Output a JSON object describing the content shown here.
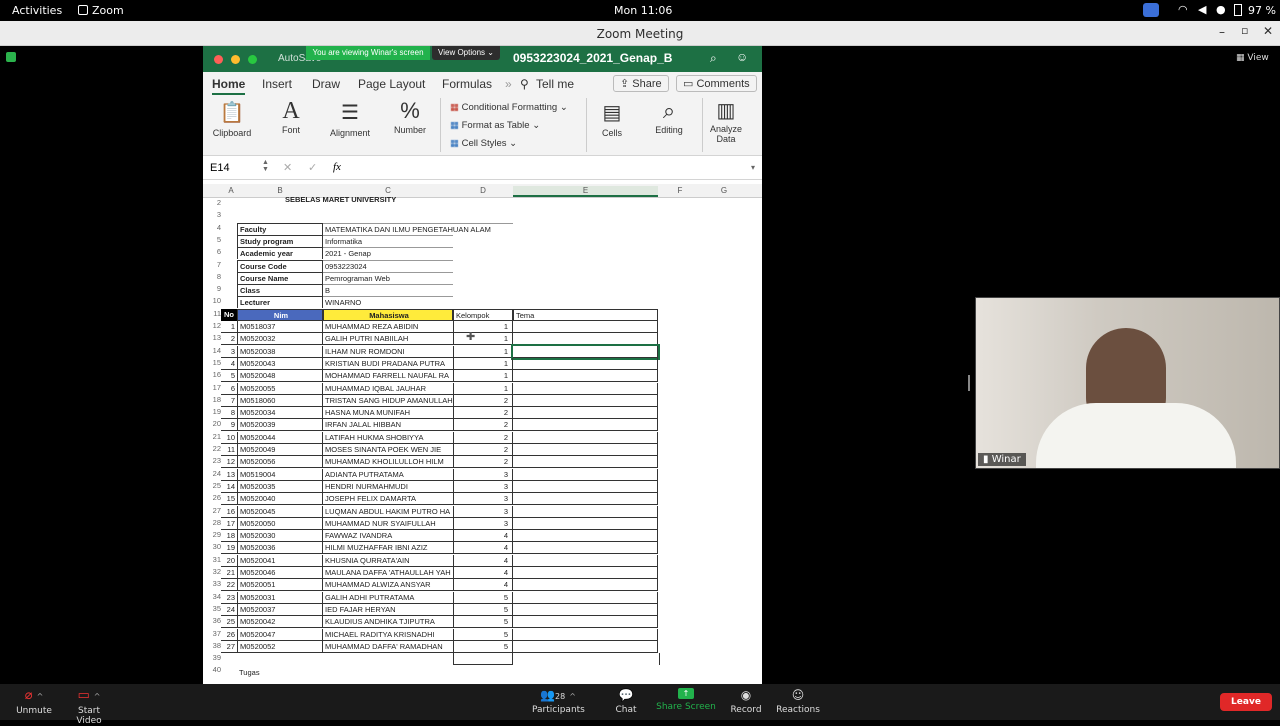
{
  "system": {
    "activities": "Activities",
    "app": "Zoom",
    "clock": "Mon 11:06",
    "battery": "97 %"
  },
  "window": {
    "title": "Zoom Meeting"
  },
  "share_banner": {
    "text": "You are viewing Winar's screen",
    "view_options": "View Options"
  },
  "excel": {
    "autosave": "AutoSave",
    "filename": "0953223024_2021_Genap_B",
    "tabs": [
      "Home",
      "Insert",
      "Draw",
      "Page Layout",
      "Formulas",
      "Tell me"
    ],
    "share": "Share",
    "comments": "Comments",
    "groups": {
      "clipboard": "Clipboard",
      "font": "Font",
      "alignment": "Alignment",
      "number": "Number",
      "cond_format": "Conditional Formatting",
      "format_table": "Format as Table",
      "cell_styles": "Cell Styles",
      "cells": "Cells",
      "editing": "Editing",
      "analyze": "Analyze Data"
    },
    "name_box": "E14",
    "fx": "fx",
    "columns": [
      "A",
      "B",
      "C",
      "D",
      "E",
      "F",
      "G"
    ]
  },
  "sheet": {
    "row2_text": "SEBELAS MARET UNIVERSITY",
    "info": [
      {
        "r": 4,
        "label": "Faculty",
        "value": "MATEMATIKA DAN ILMU PENGETAHUAN ALAM"
      },
      {
        "r": 5,
        "label": "Study program",
        "value": "Informatika"
      },
      {
        "r": 6,
        "label": "Academic year",
        "value": "2021 - Genap"
      },
      {
        "r": 7,
        "label": "Course Code",
        "value": "0953223024"
      },
      {
        "r": 8,
        "label": "Course Name",
        "value": "Pemrograman Web"
      },
      {
        "r": 9,
        "label": "Class",
        "value": "B"
      },
      {
        "r": 10,
        "label": "Lecturer",
        "value": "WINARNO"
      }
    ],
    "headers": {
      "no": "No",
      "nim": "Nim",
      "mahasiswa": "Mahasiswa",
      "kelompok": "Kelompok",
      "tema": "Tema"
    },
    "students": [
      [
        "1",
        "M0518037",
        "MUHAMMAD REZA ABIDIN",
        "1"
      ],
      [
        "2",
        "M0520032",
        "GALIH PUTRI NABIILAH",
        "1"
      ],
      [
        "3",
        "M0520038",
        "ILHAM NUR ROMDONI",
        "1"
      ],
      [
        "4",
        "M0520043",
        "KRISTIAN BUDI PRADANA PUTRA",
        "1"
      ],
      [
        "5",
        "M0520048",
        "MOHAMMAD FARRELL NAUFAL RA",
        "1"
      ],
      [
        "6",
        "M0520055",
        "MUHAMMAD IQBAL JAUHAR",
        "1"
      ],
      [
        "7",
        "M0518060",
        "TRISTAN SANG HIDUP AMANULLAH",
        "2"
      ],
      [
        "8",
        "M0520034",
        "HASNA MUNA MUNIFAH",
        "2"
      ],
      [
        "9",
        "M0520039",
        "IRFAN JALAL HIBBAN",
        "2"
      ],
      [
        "10",
        "M0520044",
        "LATIFAH HUKMA SHOBIYYA",
        "2"
      ],
      [
        "11",
        "M0520049",
        "MOSES SINANTA POEK WEN JIE",
        "2"
      ],
      [
        "12",
        "M0520056",
        "MUHAMMAD KHOLILULLOH HILM",
        "2"
      ],
      [
        "13",
        "M0519004",
        "ADIANTA PUTRATAMA",
        "3"
      ],
      [
        "14",
        "M0520035",
        "HENDRI NURMAHMUDI",
        "3"
      ],
      [
        "15",
        "M0520040",
        "JOSEPH FELIX DAMARTA",
        "3"
      ],
      [
        "16",
        "M0520045",
        "LUQMAN ABDUL HAKIM PUTRO HA",
        "3"
      ],
      [
        "17",
        "M0520050",
        "MUHAMMAD NUR SYAIFULLAH",
        "3"
      ],
      [
        "18",
        "M0520030",
        "FAWWAZ IVANDRA",
        "4"
      ],
      [
        "19",
        "M0520036",
        "HILMI MUZHAFFAR IBNI AZIZ",
        "4"
      ],
      [
        "20",
        "M0520041",
        "KHUSNIA QURRATA'AIN",
        "4"
      ],
      [
        "21",
        "M0520046",
        "MAULANA DAFFA 'ATHAULLAH YAH",
        "4"
      ],
      [
        "22",
        "M0520051",
        "MUHAMMAD ALWIZA ANSYAR",
        "4"
      ],
      [
        "23",
        "M0520031",
        "GALIH ADHI PUTRATAMA",
        "5"
      ],
      [
        "24",
        "M0520037",
        "IED FAJAR HERYAN",
        "5"
      ],
      [
        "25",
        "M0520042",
        "KLAUDIUS ANDHIKA TJIPUTRA",
        "5"
      ],
      [
        "26",
        "M0520047",
        "MICHAEL RADITYA KRISNADHI",
        "5"
      ],
      [
        "27",
        "M0520052",
        "MUHAMMAD DAFFA' RAMADHAN",
        "5"
      ]
    ],
    "row40_text": "Tugas"
  },
  "video": {
    "name": "Winar"
  },
  "view_btn": "View",
  "toolbar": {
    "unmute": "Unmute",
    "start_video": "Start Video",
    "participants": "Participants",
    "participants_count": "28",
    "chat": "Chat",
    "share_screen": "Share Screen",
    "record": "Record",
    "reactions": "Reactions",
    "leave": "Leave"
  },
  "colors": {
    "excel_green": "#1d7044",
    "share_green": "#22b24c",
    "leave_red": "#e02828",
    "header_blue": "#4a69bd",
    "header_yellow": "#ffeb3b"
  }
}
